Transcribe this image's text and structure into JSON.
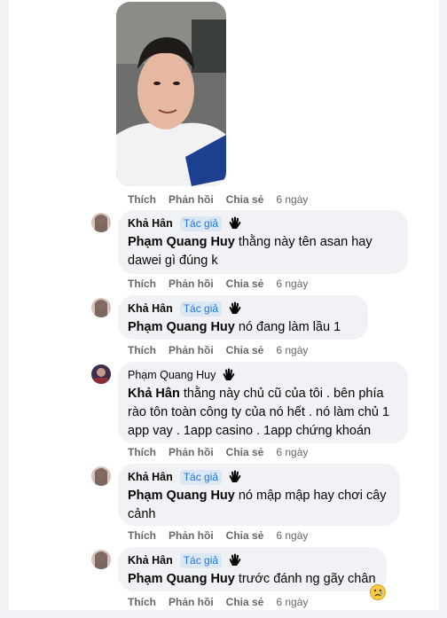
{
  "action_labels": {
    "like": "Thích",
    "reply": "Phản hồi",
    "share": "Chia sẻ",
    "time": "6 ngày"
  },
  "comments": [
    {
      "author": "Khả Hân",
      "badge": "Tác giả",
      "mention": "Phạm Quang Huy",
      "text": "thằng này tên asan hay dawei gì đúng k"
    },
    {
      "author": "Khả Hân",
      "badge": "Tác giả",
      "mention": "Phạm Quang Huy",
      "text": "nó đang làm lầu 1"
    },
    {
      "author": "Phạm Quang Huy",
      "badge": "",
      "mention": "Khả Hân",
      "text": "thằng này chủ cũ của tôi . bên phía rào tôn toàn công ty của nó hết . nó làm chủ 1 app vay . 1app casino . 1app chứng khoán"
    },
    {
      "author": "Khả Hân",
      "badge": "Tác giả",
      "mention": "Phạm Quang Huy",
      "text": "nó mập mập hay chơi cây cảnh"
    },
    {
      "author": "Khả Hân",
      "badge": "Tác giả",
      "mention": "Phạm Quang Huy",
      "text": "trước đánh ng gãy chân"
    }
  ],
  "icons": {
    "wave": "wave-hand-icon",
    "reaction": "sad-face-emoji"
  }
}
